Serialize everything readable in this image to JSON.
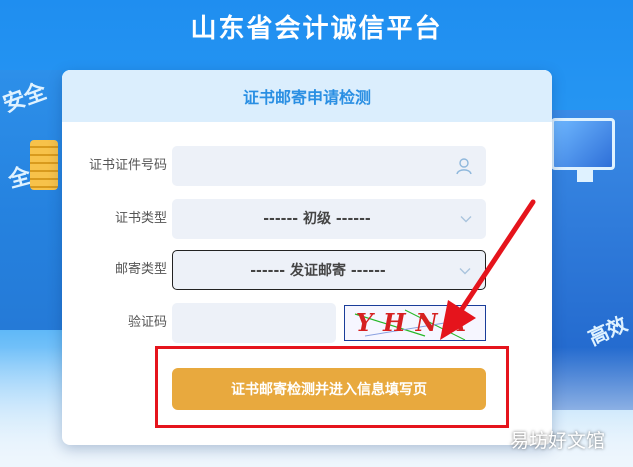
{
  "site": {
    "title": "山东省会计诚信平台"
  },
  "form": {
    "heading": "证书邮寄申请检测",
    "cert_id": {
      "label": "证书证件号码",
      "value": "",
      "placeholder": ""
    },
    "cert_type": {
      "label": "证书类型",
      "selected": "------ 初级 ------"
    },
    "mail_type": {
      "label": "邮寄类型",
      "selected": "------ 发证邮寄 ------"
    },
    "captcha": {
      "label": "验证码",
      "value": "",
      "image_text": "YHNA"
    },
    "submit_label": "证书邮寄检测并进入信息填写页"
  },
  "decor": {
    "left_text_1": "安全",
    "left_text_2": "全",
    "right_text": "高效"
  },
  "annotation": {
    "color": "#e5141c"
  },
  "watermark": "易坊好文馆",
  "colors": {
    "accent": "#2a8fe3",
    "button": "#e8a93e",
    "background": "#1f8ef0"
  }
}
